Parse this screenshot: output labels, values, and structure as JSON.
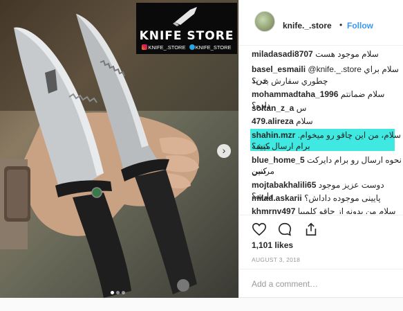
{
  "post": {
    "logo": {
      "title": "KNIFE STORE",
      "instagram_handle": "KNIFE_.STORE",
      "telegram_handle": "KNIFE_STORE",
      "icon": "knife-icon"
    },
    "carousel": {
      "next_icon": "›",
      "dots_total": 3,
      "active_dot": 1
    }
  },
  "header": {
    "username": "knife._.store",
    "separator": "•",
    "follow_label": "Follow"
  },
  "comments": [
    {
      "user": "miladasadi8707",
      "text": "سلام موجود هست"
    },
    {
      "user": "basel_esmaili",
      "text": "@knife._.store سلام براي خريد"
    },
    {
      "user": "",
      "text": "چطوري سفارش بدن؟"
    },
    {
      "user": "mohammadtaha_1996",
      "text": "سلام ضمانتم داره؟"
    },
    {
      "user": "soltan_z_a",
      "text": "س"
    },
    {
      "user": "479.alireza",
      "text": "سلام"
    },
    {
      "user": "shahin.mzr",
      "text": "سلام، من این چاقو رو میخوام. میشه"
    },
    {
      "user": "",
      "text": "برام ارسال کنید؟"
    },
    {
      "user": "blue_home_5",
      "text": "نحوه ارسال رو برام دایرکت کنین"
    },
    {
      "user": "",
      "text": "مرسی"
    },
    {
      "user": "mojtabakhalili65",
      "text": "دوست عزیز موجود دارید؟"
    },
    {
      "user": "milad.askarii",
      "text": "پایینی موجوده داداش؟"
    },
    {
      "user": "khmrnv497",
      "text": "سلام من بدونه از چاقو کلمبیا که"
    }
  ],
  "actions": {
    "like_icon": "heart-icon",
    "comment_icon": "comment-bubble-icon",
    "share_icon": "share-icon"
  },
  "likes_text": "1,101 likes",
  "date_text": "AUGUST 3, 2018",
  "add_comment_placeholder": "Add a comment…",
  "colors": {
    "follow": "#3897f0",
    "highlight": "#3fe8e0"
  }
}
